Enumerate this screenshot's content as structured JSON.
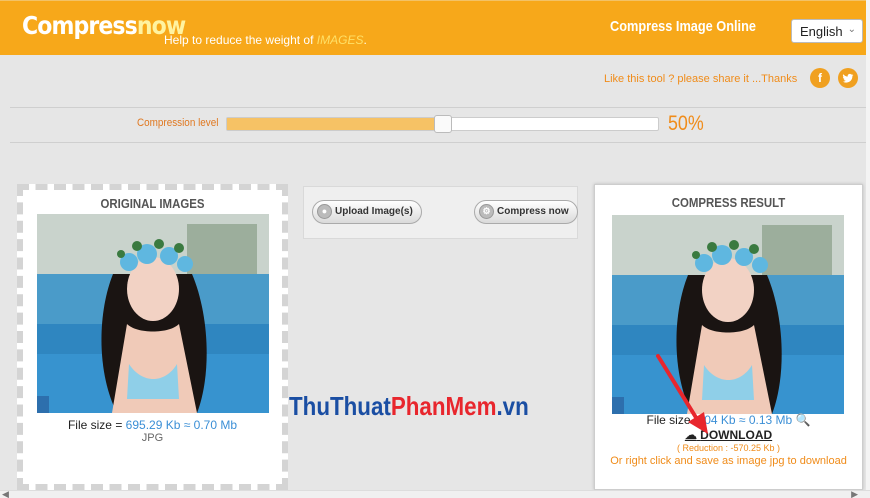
{
  "header": {
    "logo_main": "Compress",
    "logo_accent": "now",
    "tagline_prefix": "Help to reduce the weight of",
    "tagline_highlight": "IMAGES",
    "tagline_suffix": ".",
    "title": "Compress Image Online",
    "language": "English"
  },
  "share": {
    "text": "Like this tool ? please share it ...Thanks",
    "facebook_icon": "facebook-icon",
    "twitter_icon": "twitter-icon"
  },
  "compression": {
    "label": "Compression level",
    "value_text": "50%",
    "level": 0.5
  },
  "original": {
    "title": "ORIGINAL IMAGES",
    "filesize_label": "File size =",
    "filesize_kb": "695.29 Kb",
    "approx": "≈",
    "filesize_mb": "0.70 Mb",
    "format": "JPG"
  },
  "actions": {
    "upload_label": "Upload Image(s)",
    "compress_label": "Compress now"
  },
  "result": {
    "title": "COMPRESS RESULT",
    "filesize_label": "File size =",
    "filesize_kb": "04 Kb",
    "approx": "≈",
    "filesize_mb": "0.13 Mb",
    "download_label": "DOWNLOAD",
    "reduction": "( Reduction : -570.25 Kb )",
    "right_click_hint": "Or right click and save as image jpg to download"
  },
  "watermark": {
    "part1": "ThuThuat",
    "part2": "PhanMem",
    "part3": ".vn"
  },
  "colors": {
    "header": "#f7a81a",
    "accent": "#f08c1a",
    "link_blue": "#3b8fd6",
    "arrow": "#e8262d"
  }
}
